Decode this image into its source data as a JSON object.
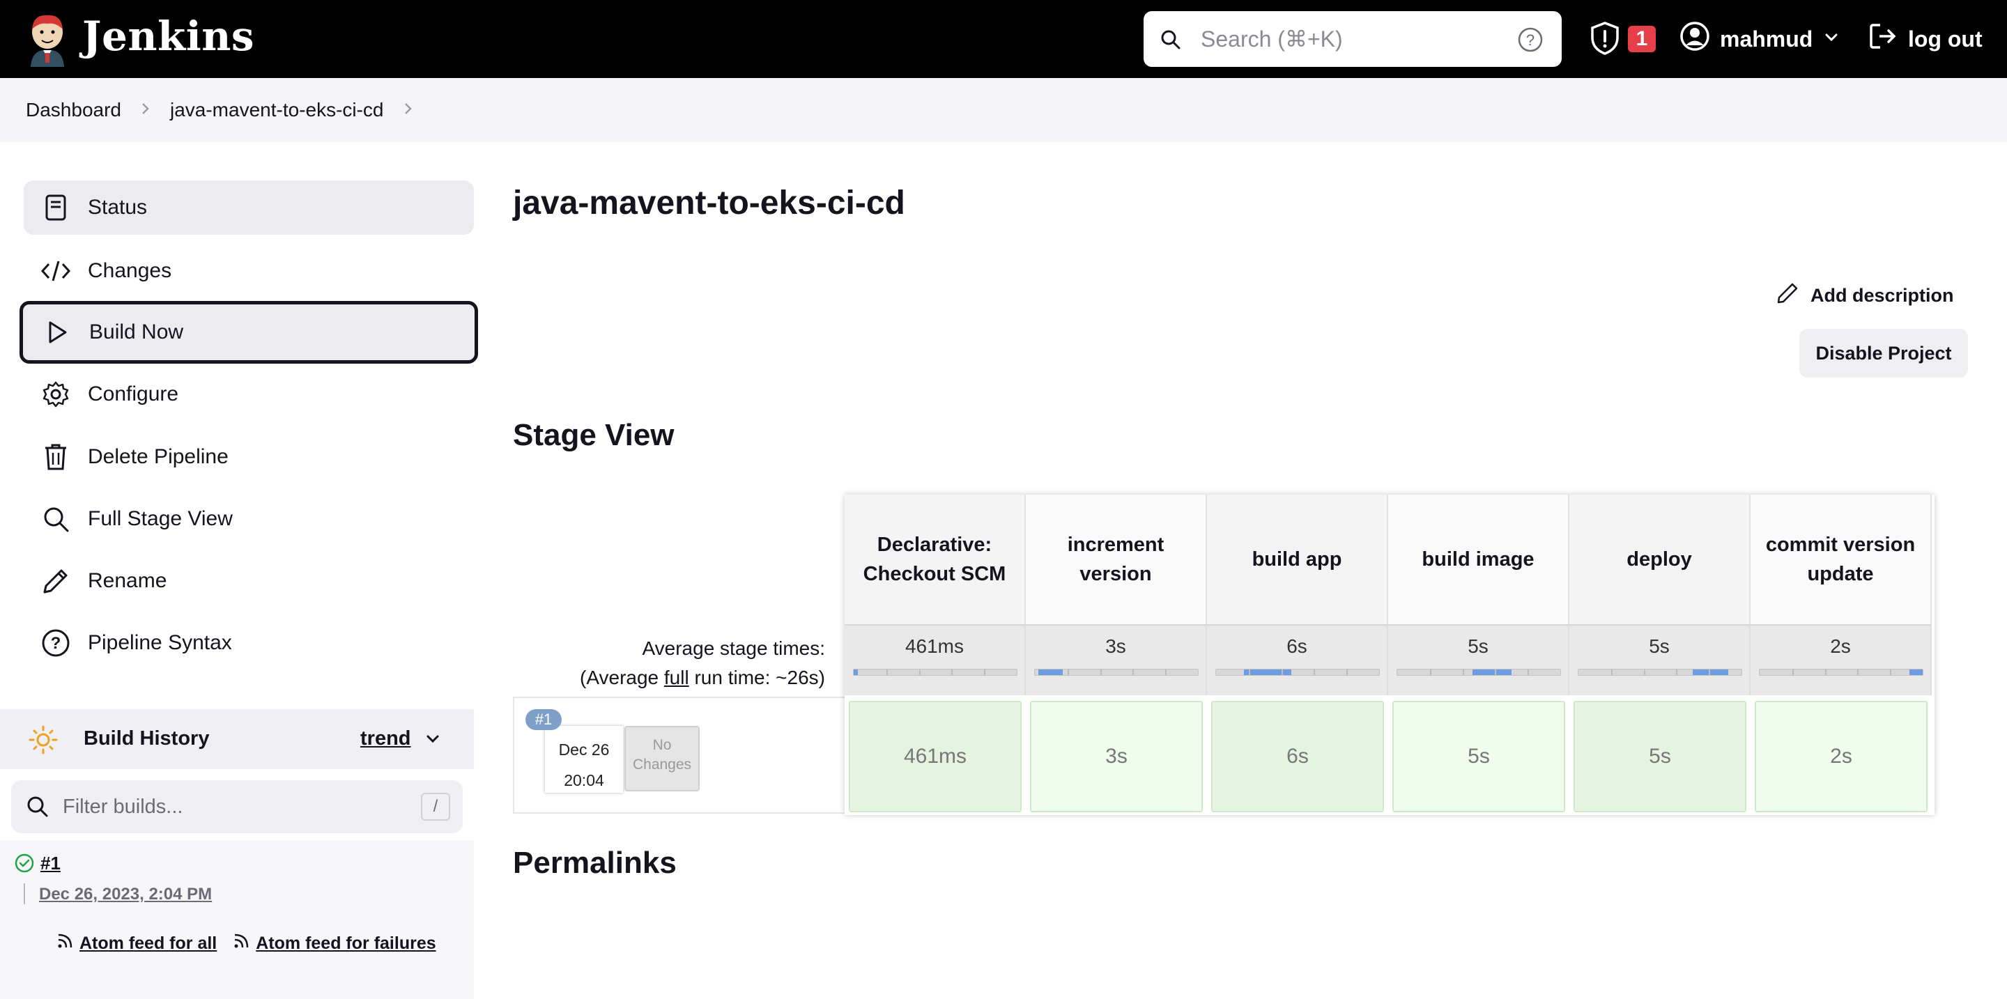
{
  "app": {
    "brand": "Jenkins"
  },
  "header": {
    "search_placeholder": "Search (⌘+K)",
    "security_count": "1",
    "username": "mahmud",
    "logout_label": "log out"
  },
  "breadcrumb": [
    "Dashboard",
    "java-mavent-to-eks-ci-cd"
  ],
  "sidebar": {
    "items": [
      {
        "label": "Status",
        "icon": "status-icon"
      },
      {
        "label": "Changes",
        "icon": "code-icon"
      },
      {
        "label": "Build Now",
        "icon": "play-icon"
      },
      {
        "label": "Configure",
        "icon": "gear-icon"
      },
      {
        "label": "Delete Pipeline",
        "icon": "trash-icon"
      },
      {
        "label": "Full Stage View",
        "icon": "search-icon"
      },
      {
        "label": "Rename",
        "icon": "pencil-icon"
      },
      {
        "label": "Pipeline Syntax",
        "icon": "help-icon"
      }
    ]
  },
  "build_history": {
    "title": "Build History",
    "trend_label": "trend",
    "filter_placeholder": "Filter builds...",
    "filter_shortcut": "/",
    "builds": [
      {
        "number": "#1",
        "date": "Dec 26, 2023, 2:04 PM",
        "status": "success"
      }
    ],
    "feed_all": "Atom feed for all",
    "feed_failures": "Atom feed for failures"
  },
  "main": {
    "title": "java-mavent-to-eks-ci-cd",
    "add_description": "Add description",
    "disable_project": "Disable Project",
    "stage_view_title": "Stage View",
    "permalinks_title": "Permalinks"
  },
  "stage_view": {
    "avg_label": "Average stage times:",
    "avg_full_prefix": "(Average ",
    "avg_full_word": "full",
    "avg_full_suffix": " run time: ~26s)",
    "run": {
      "badge": "#1",
      "date": "Dec 26",
      "time": "20:04",
      "changes": "No Changes"
    },
    "stages": [
      {
        "name": "Declarative: Checkout SCM",
        "avg": "461ms",
        "run": "461ms",
        "bar_start": 0.0,
        "bar_end": 0.02
      },
      {
        "name": "increment version",
        "avg": "3s",
        "run": "3s",
        "bar_start": 0.02,
        "bar_end": 0.17
      },
      {
        "name": "build app",
        "avg": "6s",
        "run": "6s",
        "bar_start": 0.17,
        "bar_end": 0.46
      },
      {
        "name": "build image",
        "avg": "5s",
        "run": "5s",
        "bar_start": 0.46,
        "bar_end": 0.7
      },
      {
        "name": "deploy",
        "avg": "5s",
        "run": "5s",
        "bar_start": 0.7,
        "bar_end": 0.92
      },
      {
        "name": "commit version update",
        "avg": "2s",
        "run": "2s",
        "bar_start": 0.92,
        "bar_end": 1.0
      }
    ]
  },
  "colors": {
    "header_bg": "#000000",
    "accent_bar": "#6d9ce0",
    "success_cell": "#e4f4e0",
    "badge_red": "#e5404a"
  }
}
